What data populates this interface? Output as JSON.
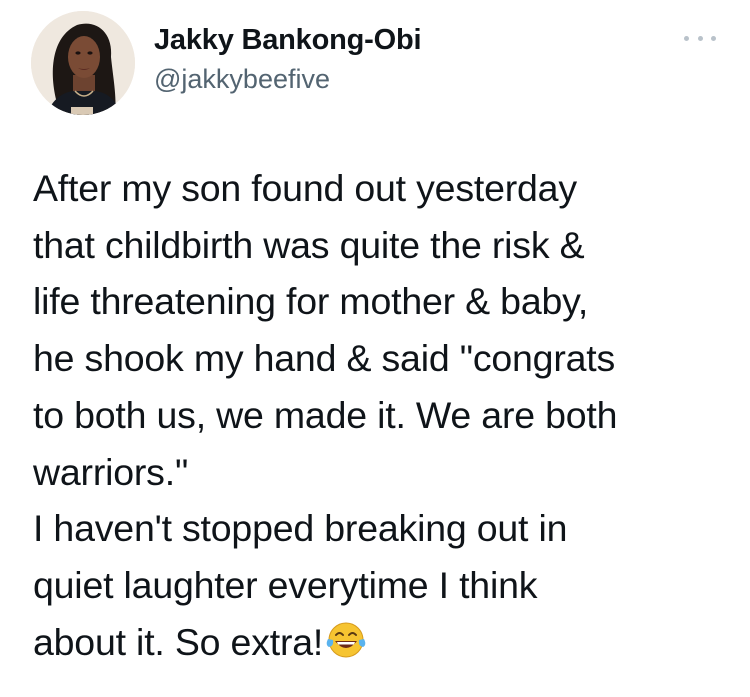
{
  "author": {
    "name": "Jakky Bankong-Obi",
    "handle": "@jakkybeefive"
  },
  "more_icon": "more-horizontal-icon",
  "tweet": {
    "lines": [
      "After my son found out yesterday",
      "that childbirth was quite the risk &",
      "life threatening for mother & baby,",
      "he shook my hand & said \"congrats",
      "to both us, we made it. We are both",
      "warriors.\"",
      "I haven't stopped breaking out in",
      "quiet laughter everytime I think",
      "about it. So extra!"
    ],
    "emoji": "tears-of-joy-emoji"
  },
  "colors": {
    "text": "#0f1419",
    "secondary": "#536471",
    "background": "#ffffff"
  }
}
